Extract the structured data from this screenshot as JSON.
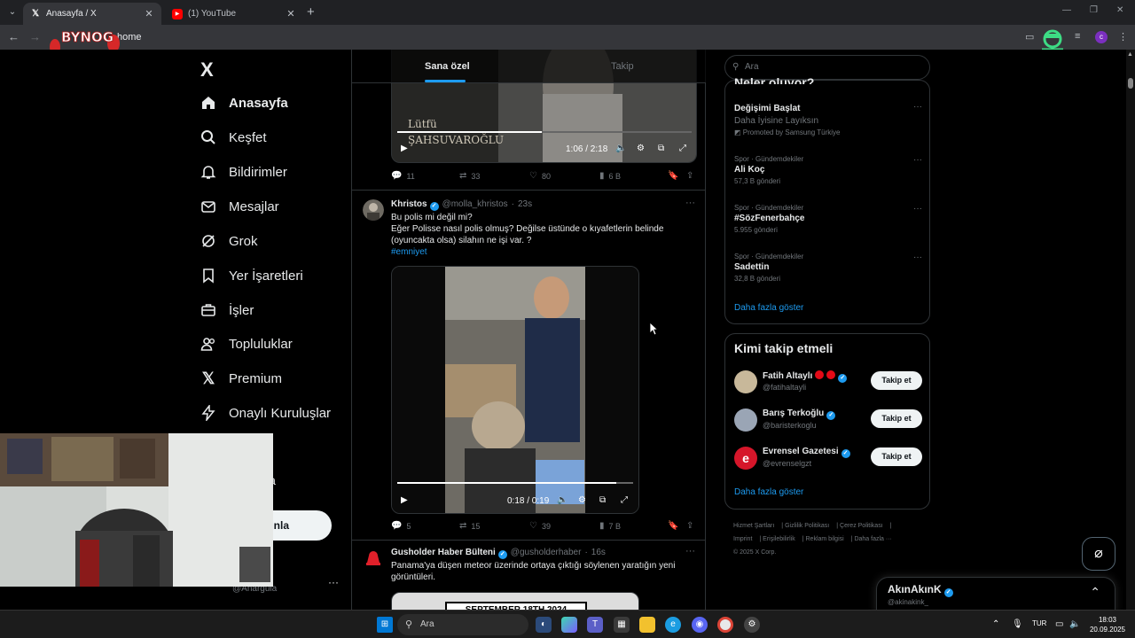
{
  "browser": {
    "tabs": [
      {
        "title": "Anasayfa / X",
        "active": true
      },
      {
        "title": "(1) YouTube",
        "active": false
      }
    ],
    "address": "home",
    "profile_initial": "c",
    "new_tab": "+",
    "overlay_logo_text": "BYNOG"
  },
  "nav": {
    "logo": "X",
    "items": [
      {
        "label": "Anasayfa",
        "icon": "home-icon"
      },
      {
        "label": "Keşfet",
        "icon": "search-icon"
      },
      {
        "label": "Bildirimler",
        "icon": "bell-icon"
      },
      {
        "label": "Mesajlar",
        "icon": "mail-icon"
      },
      {
        "label": "Grok",
        "icon": "grok-icon"
      },
      {
        "label": "Yer İşaretleri",
        "icon": "bookmark-icon"
      },
      {
        "label": "İşler",
        "icon": "briefcase-icon"
      },
      {
        "label": "Topluluklar",
        "icon": "people-icon"
      },
      {
        "label": "Premium",
        "icon": "x-icon"
      },
      {
        "label": "Onaylı Kuruluşlar",
        "icon": "lightning-icon"
      }
    ],
    "partial_more_label": "zla",
    "post_button": "ayınla",
    "profile_handle": "@Anargula",
    "profile_more": "···"
  },
  "timeline": {
    "tabs": [
      {
        "label": "Sana özel",
        "active": true
      },
      {
        "label": "Takip",
        "active": false
      }
    ],
    "posts": [
      {
        "video_overlay_text": [
          "Lütfü",
          "ŞAHSUVAROĞLU"
        ],
        "video_time": "1:06 / 2:18",
        "video_progress": 0.49,
        "stats": {
          "replies": "11",
          "reposts": "33",
          "likes": "80",
          "views": "6 B"
        }
      },
      {
        "name": "Khristos",
        "handle": "@molla_khristos",
        "time": "23s",
        "text_lines": [
          "Bu polis mi değil mi?",
          "Eğer Polisse nasıl polis olmuş? Değilse üstünde o kıyafetlerin belinde",
          "(oyuncakta olsa) silahın ne işi var. ?"
        ],
        "hashtag": "#emniyet",
        "video_time": "0:18 / 0:19",
        "video_progress": 0.93,
        "stats": {
          "replies": "5",
          "reposts": "15",
          "likes": "39",
          "views": "7 B"
        }
      },
      {
        "name": "Gusholder Haber Bülteni",
        "handle": "@gusholderhaber",
        "time": "16s",
        "text_lines": [
          "Panama'ya düşen meteor üzerinde ortaya çıktığı söylenen yaratığın yeni",
          "görüntüleri."
        ],
        "media_caption": "SEPTEMBER 18TH 2024"
      }
    ]
  },
  "right": {
    "search_placeholder": "Ara",
    "trends_title": "Neler oluyor?",
    "trends": [
      {
        "category": "",
        "name": "Değişimi Başlat",
        "sub": "Daha İyisine Layıksın",
        "promo": "Promoted by Samsung Türkiye"
      },
      {
        "category": "Spor · Gündemdekiler",
        "name": "Ali Koç",
        "count": "57,3 B gönderi"
      },
      {
        "category": "Spor · Gündemdekiler",
        "name": "#SözFenerbahçe",
        "count": "5.955 gönderi"
      },
      {
        "category": "Spor · Gündemdekiler",
        "name": "Sadettin",
        "count": "32,8 B gönderi"
      }
    ],
    "show_more": "Daha fazla göster",
    "who_to_follow_title": "Kimi takip etmeli",
    "who_to_follow": [
      {
        "name": "Fatih Altaylı",
        "handle": "@fatihaltayli",
        "button": "Takip et",
        "avatar_color": "#c8b89a"
      },
      {
        "name": "Barış Terkoğlu",
        "handle": "@baristerkoglu",
        "button": "Takip et",
        "avatar_color": "#9aa5b5"
      },
      {
        "name": "Evrensel Gazetesi",
        "handle": "@evrenselgzt",
        "button": "Takip et",
        "avatar_color": "#d6162a"
      }
    ],
    "footer": [
      "Hizmet Şartları",
      "Gizlilik Politikası",
      "Çerez Politikası",
      "Imprint",
      "Erişilebilirlik",
      "Reklam bilgisi",
      "Daha fazla ···",
      "© 2025 X Corp."
    ],
    "messages_drawer": {
      "name": "AkınAkınK",
      "handle": "@akinakink_"
    }
  },
  "taskbar": {
    "search_placeholder": "Ara",
    "language": "TUR",
    "time": "18:03",
    "date": "20.09.2025"
  },
  "colors": {
    "accent": "#1d9bf0",
    "background": "#000000",
    "border": "#2f3336",
    "muted": "#71767b"
  }
}
